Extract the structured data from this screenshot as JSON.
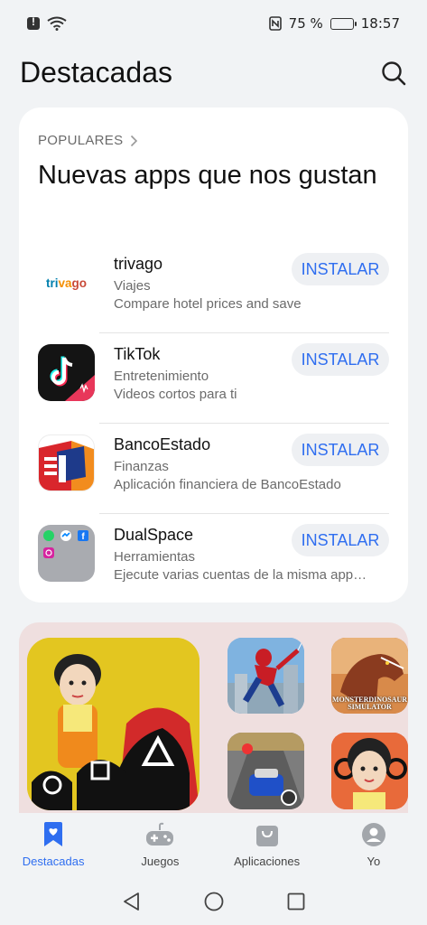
{
  "status_bar": {
    "battery": "75 %",
    "battery_level": 0.75,
    "time": "18:57"
  },
  "header": {
    "title": "Destacadas"
  },
  "section": {
    "label": "POPULARES",
    "title": "Nuevas apps que nos gustan"
  },
  "apps": [
    {
      "name": "trivago",
      "category": "Viajes",
      "description": "Compare hotel prices and save",
      "button": "INSTALAR",
      "logo_text": "trivago"
    },
    {
      "name": "TikTok",
      "category": "Entretenimiento",
      "description": "Videos cortos para ti",
      "button": "INSTALAR"
    },
    {
      "name": "BancoEstado",
      "category": "Finanzas",
      "description": "Aplicación financiera de BancoEstado",
      "button": "INSTALAR"
    },
    {
      "name": "DualSpace",
      "category": "Herramientas",
      "description": "Ejecute varias cuentas de la misma app…",
      "button": "INSTALAR"
    }
  ],
  "banner": {
    "tile_text": "MONSTERDINOSAUR SIMULATOR"
  },
  "bottom_nav": [
    {
      "label": "Destacadas",
      "icon": "bookmark-heart-icon",
      "active": true
    },
    {
      "label": "Juegos",
      "icon": "gamepad-icon",
      "active": false
    },
    {
      "label": "Aplicaciones",
      "icon": "shopping-bag-icon",
      "active": false
    },
    {
      "label": "Yo",
      "icon": "profile-icon",
      "active": false
    }
  ],
  "colors": {
    "accent": "#2f6ef0",
    "install_bg": "#eef0f3",
    "banner_bg": "#efdfdf"
  }
}
